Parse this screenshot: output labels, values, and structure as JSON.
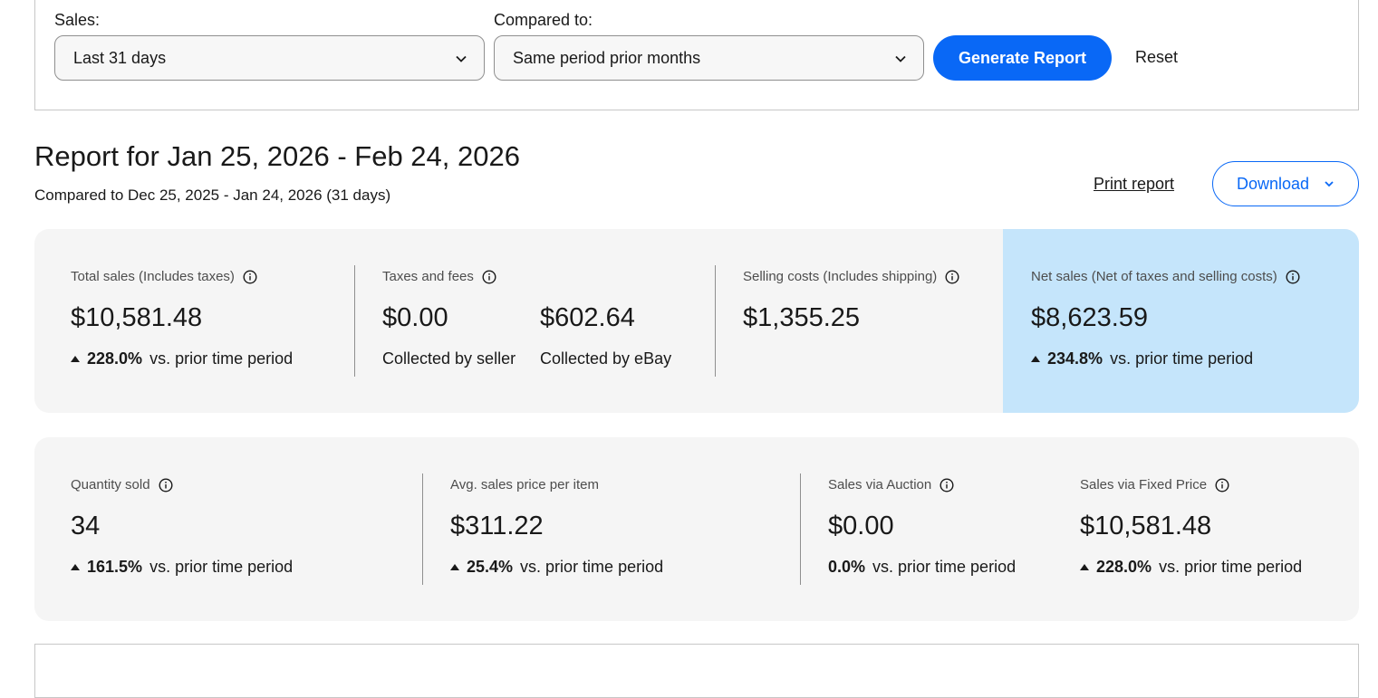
{
  "filters": {
    "sales_label": "Sales:",
    "sales_value": "Last 31 days",
    "compared_label": "Compared to:",
    "compared_value": "Same period prior months",
    "generate_label": "Generate Report",
    "reset_label": "Reset"
  },
  "report": {
    "title": "Report for Jan 25, 2026 - Feb 24, 2026",
    "subtitle": "Compared to Dec 25, 2025 - Jan 24, 2026 (31 days)",
    "print_label": "Print report",
    "download_label": "Download"
  },
  "summary": {
    "total_sales": {
      "label": "Total sales (Includes taxes)",
      "value": "$10,581.48",
      "change": "228.0%",
      "change_text": "vs. prior time period"
    },
    "taxes_fees": {
      "label": "Taxes and fees",
      "seller_value": "$0.00",
      "seller_label": "Collected by seller",
      "ebay_value": "$602.64",
      "ebay_label": "Collected by eBay"
    },
    "selling_costs": {
      "label": "Selling costs (Includes shipping)",
      "value": "$1,355.25"
    },
    "net_sales": {
      "label": "Net sales (Net of taxes and selling costs)",
      "value": "$8,623.59",
      "change": "234.8%",
      "change_text": "vs. prior time period"
    }
  },
  "details": {
    "quantity": {
      "label": "Quantity sold",
      "value": "34",
      "change": "161.5%",
      "change_text": "vs. prior time period"
    },
    "avg_price": {
      "label": "Avg. sales price per item",
      "value": "$311.22",
      "change": "25.4%",
      "change_text": "vs. prior time period"
    },
    "auction": {
      "label": "Sales via Auction",
      "value": "$0.00",
      "change": "0.0%",
      "change_text": "vs. prior time period"
    },
    "fixed_price": {
      "label": "Sales via Fixed Price",
      "value": "$10,581.48",
      "change": "228.0%",
      "change_text": "vs. prior time period"
    }
  },
  "colors": {
    "primary": "#0968f6",
    "net_highlight": "#c5e5fb",
    "card_bg": "#f5f5f5"
  }
}
